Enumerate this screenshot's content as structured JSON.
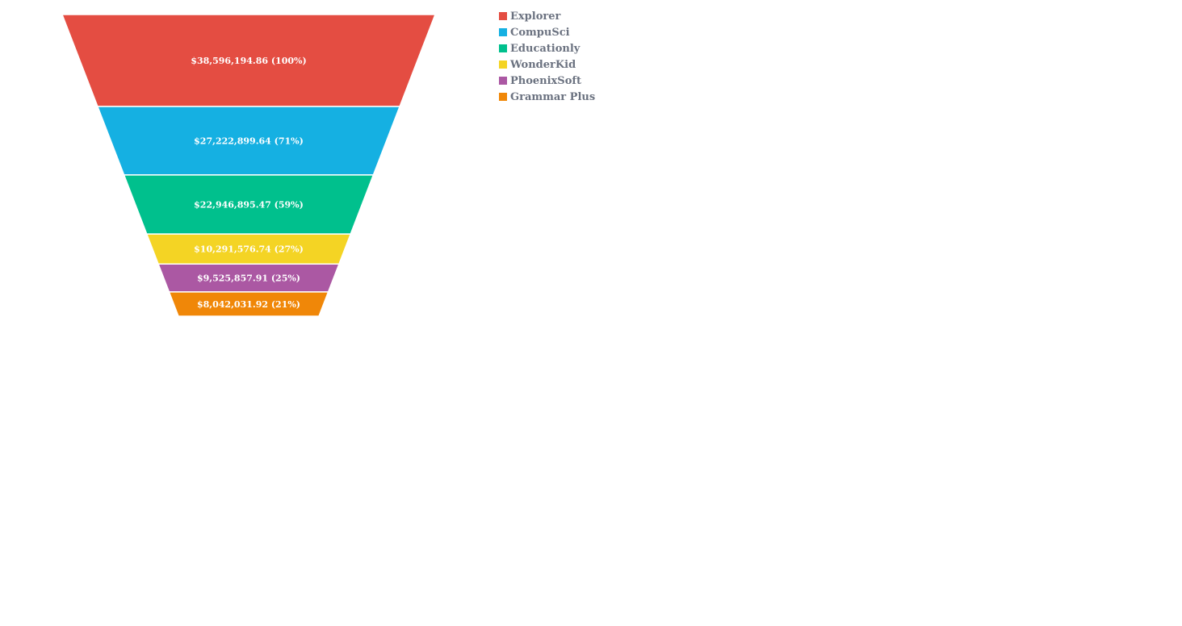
{
  "chart_data": {
    "type": "funnel",
    "categories": [
      "Explorer",
      "CompuSci",
      "Educationly",
      "WonderKid",
      "PhoenixSoft",
      "Grammar Plus"
    ],
    "values": [
      38596194.86,
      27222899.64,
      22946895.47,
      10291576.74,
      9525857.91,
      8042031.92
    ],
    "percents": [
      100,
      71,
      59,
      27,
      25,
      21
    ],
    "labels": [
      "$38,596,194.86 (100%)",
      "$27,222,899.64 (71%)",
      "$22,946,895.47 (59%)",
      "$10,291,576.74 (27%)",
      "$9,525,857.91 (25%)",
      "$8,042,031.92 (21%)"
    ],
    "colors": [
      "#e44d42",
      "#15b0e2",
      "#00c08d",
      "#f4d424",
      "#ab58a3",
      "#f08708"
    ],
    "legend_position": "top-right"
  },
  "legend": {
    "items": [
      {
        "label": "Explorer",
        "color": "#e44d42"
      },
      {
        "label": "CompuSci",
        "color": "#15b0e2"
      },
      {
        "label": "Educationly",
        "color": "#00c08d"
      },
      {
        "label": "WonderKid",
        "color": "#f4d424"
      },
      {
        "label": "PhoenixSoft",
        "color": "#ab58a3"
      },
      {
        "label": "Grammar Plus",
        "color": "#f08708"
      }
    ]
  }
}
